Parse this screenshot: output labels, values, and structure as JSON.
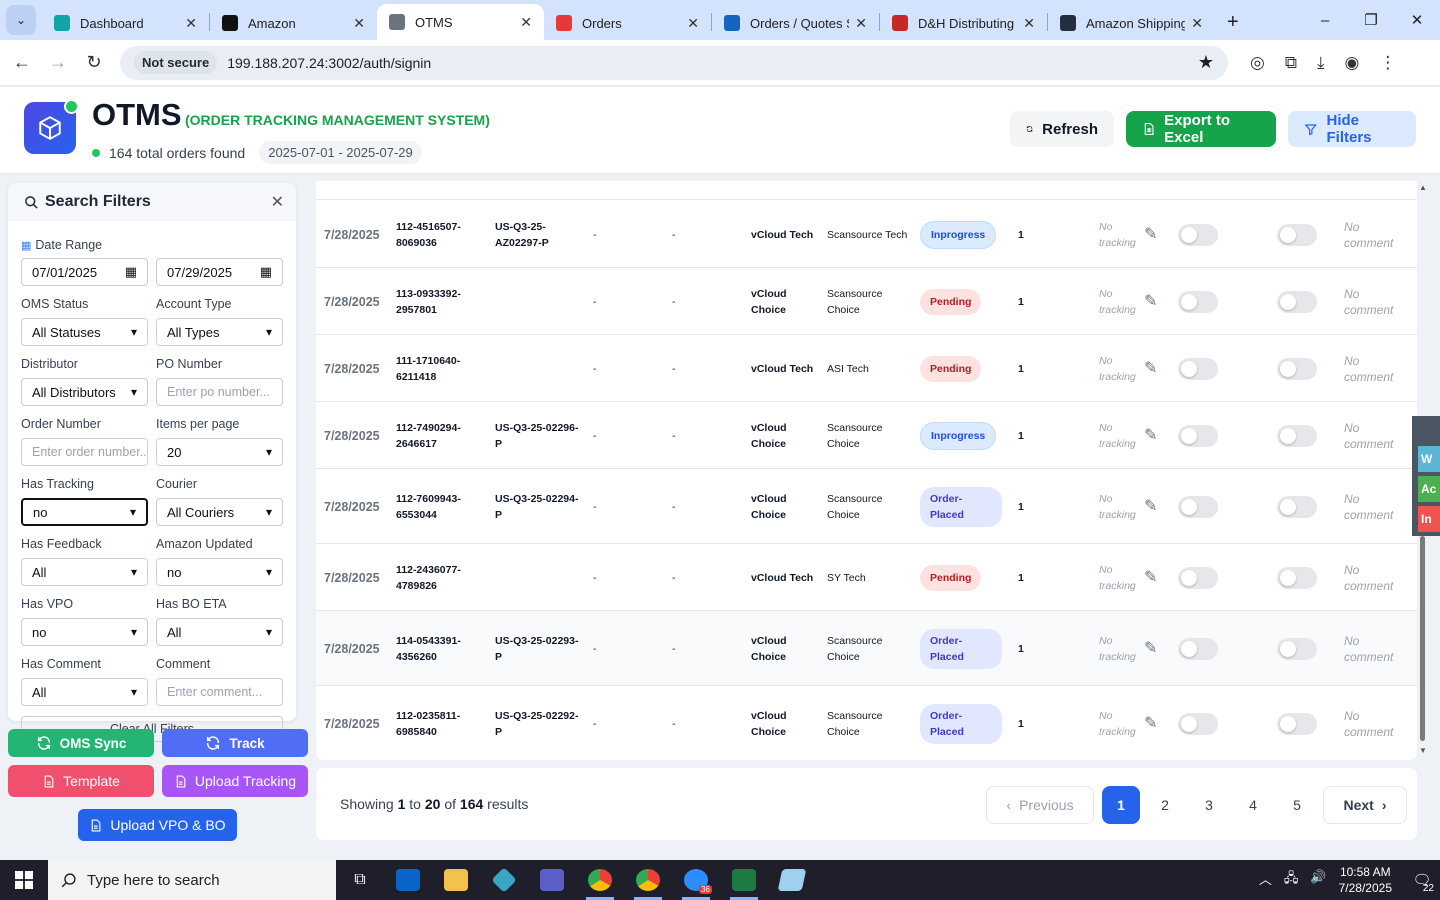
{
  "browser": {
    "tabs": [
      {
        "title": "Dashboard",
        "favicon_color": "#0ea5a4",
        "active": false
      },
      {
        "title": "Amazon",
        "favicon_color": "#111111",
        "active": false
      },
      {
        "title": "OTMS",
        "favicon_color": "#6b7280",
        "active": true
      },
      {
        "title": "Orders",
        "favicon_color": "#e53935",
        "active": false
      },
      {
        "title": "Orders / Quotes S",
        "favicon_color": "#1565c0",
        "active": false
      },
      {
        "title": "D&H Distributing",
        "favicon_color": "#c62828",
        "active": false
      },
      {
        "title": "Amazon Shipping",
        "favicon_color": "#232f3e",
        "active": false
      }
    ],
    "not_secure": "Not secure",
    "url": "199.188.207.24:3002/auth/signin"
  },
  "header": {
    "brand": "OTMS",
    "brand_subtitle": "(ORDER TRACKING MANAGEMENT SYSTEM)",
    "total_orders": "164 total orders found",
    "date_range": "2025-07-01 - 2025-07-29",
    "refresh_label": "Refresh",
    "export_label": "Export to Excel",
    "hide_filters_label": "Hide Filters"
  },
  "filters": {
    "title": "Search Filters",
    "date_range_label": "Date Range",
    "date_from": "07/01/2025",
    "date_to": "07/29/2025",
    "oms_status_label": "OMS Status",
    "oms_status_value": "All Statuses",
    "account_type_label": "Account Type",
    "account_type_value": "All Types",
    "distributor_label": "Distributor",
    "distributor_value": "All Distributors",
    "po_number_label": "PO Number",
    "po_number_placeholder": "Enter po number...",
    "order_number_label": "Order Number",
    "order_number_placeholder": "Enter order number...",
    "items_per_page_label": "Items per page",
    "items_per_page_value": "20",
    "has_tracking_label": "Has Tracking",
    "has_tracking_value": "no",
    "courier_label": "Courier",
    "courier_value": "All Couriers",
    "has_feedback_label": "Has Feedback",
    "has_feedback_value": "All",
    "amazon_updated_label": "Amazon Updated",
    "amazon_updated_value": "no",
    "has_vpo_label": "Has VPO",
    "has_vpo_value": "no",
    "has_bo_eta_label": "Has BO ETA",
    "has_bo_eta_value": "All",
    "has_comment_label": "Has Comment",
    "has_comment_value": "All",
    "comment_label": "Comment",
    "comment_placeholder": "Enter comment...",
    "clear_label": "Clear All Filters"
  },
  "actions": {
    "oms_sync": "OMS Sync",
    "track": "Track",
    "template": "Template",
    "upload_tracking": "Upload Tracking",
    "upload_vpo": "Upload VPO & BO"
  },
  "orders": [
    {
      "date": "7/28/2025",
      "order": "112-4516507-8069036",
      "po": "US-Q3-25-AZ02297-P",
      "d1": "-",
      "d2": "-",
      "account": "vCloud Tech",
      "distributor": "Scansource Tech",
      "status": "Inprogress",
      "qty": "1",
      "tracking": "No tracking",
      "comment": "No comment"
    },
    {
      "date": "7/28/2025",
      "order": "113-0933392-2957801",
      "po": "",
      "d1": "-",
      "d2": "-",
      "account": "vCloud Choice",
      "distributor": "Scansource Choice",
      "status": "Pending",
      "qty": "1",
      "tracking": "No tracking",
      "comment": "No comment"
    },
    {
      "date": "7/28/2025",
      "order": "111-1710640-6211418",
      "po": "",
      "d1": "-",
      "d2": "-",
      "account": "vCloud Tech",
      "distributor": "ASI Tech",
      "status": "Pending",
      "qty": "1",
      "tracking": "No tracking",
      "comment": "No comment"
    },
    {
      "date": "7/28/2025",
      "order": "112-7490294-2646617",
      "po": "US-Q3-25-02296-P",
      "d1": "-",
      "d2": "-",
      "account": "vCloud Choice",
      "distributor": "Scansource Choice",
      "status": "Inprogress",
      "qty": "1",
      "tracking": "No tracking",
      "comment": "No comment"
    },
    {
      "date": "7/28/2025",
      "order": "112-7609943-6553044",
      "po": "US-Q3-25-02294-P",
      "d1": "-",
      "d2": "-",
      "account": "vCloud Choice",
      "distributor": "Scansource Choice",
      "status": "Order-Placed",
      "qty": "1",
      "tracking": "No tracking",
      "comment": "No comment"
    },
    {
      "date": "7/28/2025",
      "order": "112-2436077-4789826",
      "po": "",
      "d1": "-",
      "d2": "-",
      "account": "vCloud Tech",
      "distributor": "SY Tech",
      "status": "Pending",
      "qty": "1",
      "tracking": "No tracking",
      "comment": "No comment"
    },
    {
      "date": "7/28/2025",
      "order": "114-0543391-4356260",
      "po": "US-Q3-25-02293-P",
      "d1": "-",
      "d2": "-",
      "account": "vCloud Choice",
      "distributor": "Scansource Choice",
      "status": "Order-Placed",
      "qty": "1",
      "tracking": "No tracking",
      "comment": "No comment"
    },
    {
      "date": "7/28/2025",
      "order": "112-0235811-6985840",
      "po": "US-Q3-25-02292-P",
      "d1": "-",
      "d2": "-",
      "account": "vCloud Choice",
      "distributor": "Scansource Choice",
      "status": "Order-Placed",
      "qty": "1",
      "tracking": "No tracking",
      "comment": "No comment"
    }
  ],
  "pagination": {
    "showing_prefix": "Showing",
    "from": "1",
    "to_word": "to",
    "to": "20",
    "of_word": "of",
    "total": "164",
    "results_word": "results",
    "previous": "Previous",
    "next": "Next",
    "pages": [
      "1",
      "2",
      "3",
      "4",
      "5"
    ],
    "current_page": "1"
  },
  "side_tabs": [
    {
      "label": "W",
      "color": "#5bb5d5"
    },
    {
      "label": "Ac",
      "color": "#4caf50"
    },
    {
      "label": "In",
      "color": "#ef5350"
    }
  ],
  "taskbar": {
    "search_placeholder": "Type here to search",
    "time": "10:58 AM",
    "date": "7/28/2025",
    "notifications": "22",
    "zoom_badge": "36"
  },
  "colors": {
    "primary": "#2563eb",
    "success": "#16a34a",
    "upload_tracking": "#a855f7",
    "template": "#f0506e",
    "logo": "#4f46e5"
  }
}
